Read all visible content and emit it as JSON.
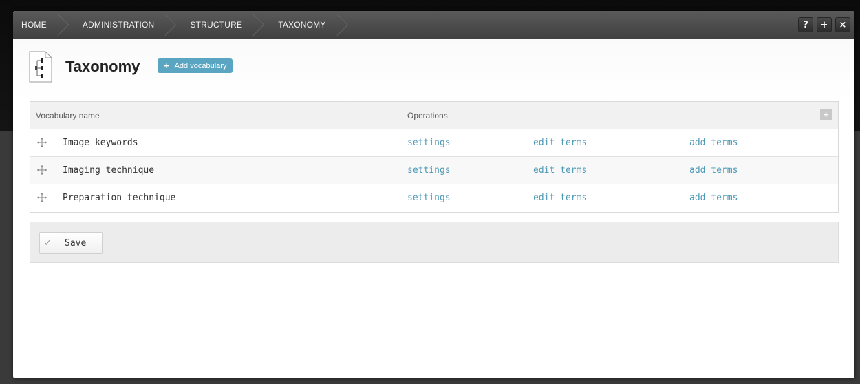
{
  "breadcrumb": {
    "items": [
      "HOME",
      "ADMINISTRATION",
      "STRUCTURE",
      "TAXONOMY"
    ]
  },
  "toolbar": {
    "help_label": "?",
    "add_label": "+",
    "close_label": "×"
  },
  "header": {
    "title": "Taxonomy",
    "add_button_plus": "+",
    "add_button_label": "Add vocabulary"
  },
  "table": {
    "columns": {
      "name": "Vocabulary name",
      "operations": "Operations"
    },
    "rows": [
      {
        "name": "Image keywords",
        "settings": "settings",
        "edit": "edit terms",
        "add": "add terms"
      },
      {
        "name": "Imaging technique",
        "settings": "settings",
        "edit": "edit terms",
        "add": "add terms"
      },
      {
        "name": "Preparation technique",
        "settings": "settings",
        "edit": "edit terms",
        "add": "add terms"
      }
    ]
  },
  "actions": {
    "save_label": "Save"
  },
  "colors": {
    "accent": "#5aa6c2",
    "link": "#4e9ab5",
    "toolbar": "#4a4a4a"
  }
}
